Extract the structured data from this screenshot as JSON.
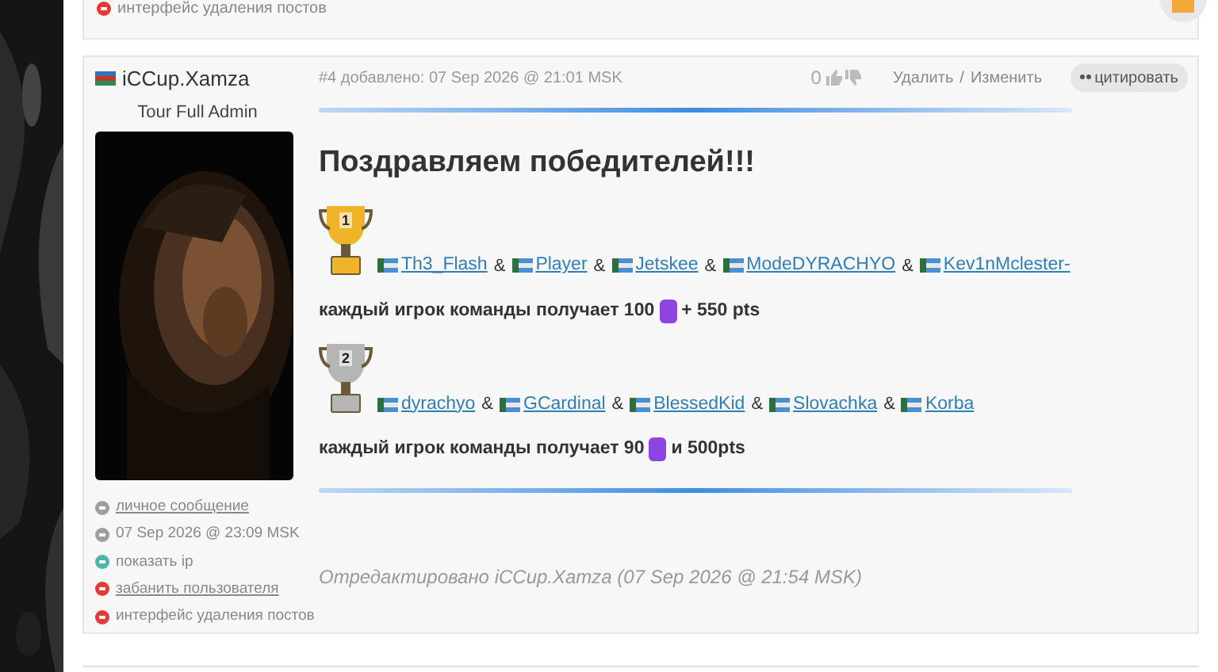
{
  "previous_post": {
    "last_action": {
      "text": "интерфейс удаления постов",
      "color": "#e53935"
    }
  },
  "post": {
    "author": "iCCup.Xamza",
    "role": "Tour Full Admin",
    "actions": [
      {
        "kind": "link",
        "text": "личное сообщение",
        "color": "#9e9e9e"
      },
      {
        "kind": "plain",
        "text": "07 Sep 2026 @ 23:09 MSK",
        "color": "#9e9e9e"
      },
      {
        "kind": "plain",
        "text": "показать ip",
        "color": "#4db6ac"
      },
      {
        "kind": "link",
        "text": "забанить пользователя",
        "color": "#e53935"
      },
      {
        "kind": "plain",
        "text": "интерфейс удаления постов",
        "color": "#e53935"
      }
    ],
    "meta": "#4 добавлено: 07 Sep 2026 @ 21:01 MSK",
    "rating": "0",
    "delete": "Удалить",
    "separator": "/",
    "edit": "Изменить",
    "quote": "цитировать",
    "heading": "Поздравляем победителей!!!",
    "places": [
      {
        "color": "#f0b429",
        "place": "1",
        "teams": [
          {
            "name": "Th3_Flash",
            "separator": "&"
          },
          {
            "name": "Player",
            "separator": "&"
          },
          {
            "name": "Jetskee",
            "separator": "&"
          },
          {
            "name": "ModeDYRACHYO",
            "separator": "&"
          },
          {
            "name": "Kev1nMclester-"
          }
        ],
        "prize_before": "каждый игрок команды получает 100",
        "prize_after": "+ 550 pts"
      },
      {
        "color": "#b5b5b5",
        "place": "2",
        "teams": [
          {
            "name": "dyrachyo",
            "separator": "&"
          },
          {
            "name": "GCardinal",
            "separator": "&"
          },
          {
            "name": "BlessedKid",
            "separator": "&"
          },
          {
            "name": "Slovachka",
            "separator": "&"
          },
          {
            "name": "Korba"
          }
        ],
        "prize_before": "каждый игрок команды получает 90",
        "prize_after": "и 500pts"
      }
    ],
    "edited": "Отредактировано iCCup.Xamza (07 Sep 2026 @ 21:54 MSK)"
  }
}
